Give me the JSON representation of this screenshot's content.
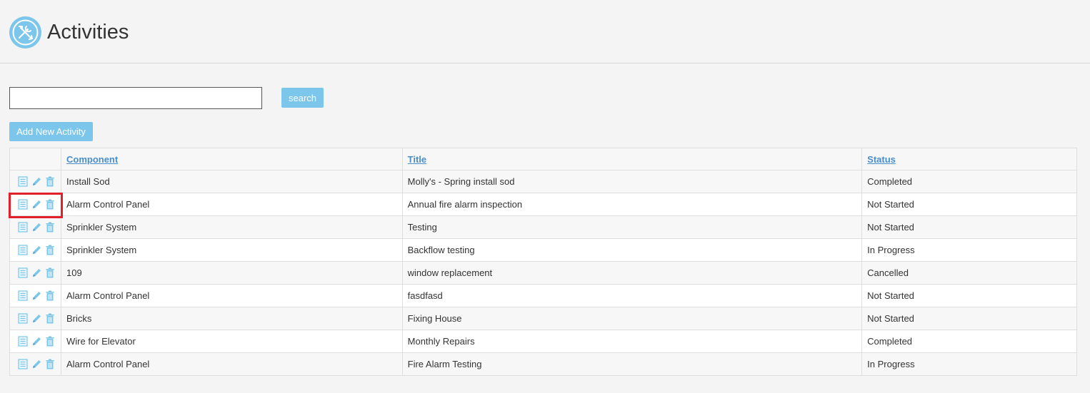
{
  "header": {
    "title": "Activities",
    "logo_icon": "tools-icon",
    "accent_color": "#7cc6ec"
  },
  "search": {
    "value": "",
    "placeholder": "",
    "button_label": "search"
  },
  "toolbar": {
    "add_label": "Add New Activity"
  },
  "table": {
    "columns": {
      "actions": "",
      "component": "Component",
      "title": "Title",
      "status": "Status"
    },
    "row_icons": [
      "details-icon",
      "edit-pencil-icon",
      "delete-trash-icon"
    ],
    "rows": [
      {
        "component": "Install Sod",
        "title": "Molly's - Spring install sod",
        "status": "Completed"
      },
      {
        "component": "Alarm Control Panel",
        "title": "Annual fire alarm inspection",
        "status": "Not Started"
      },
      {
        "component": "Sprinkler System",
        "title": "Testing",
        "status": "Not Started"
      },
      {
        "component": "Sprinkler System",
        "title": "Backflow testing",
        "status": "In Progress"
      },
      {
        "component": "109",
        "title": "window replacement",
        "status": "Cancelled"
      },
      {
        "component": "Alarm Control Panel",
        "title": "fasdfasd",
        "status": "Not Started"
      },
      {
        "component": "Bricks",
        "title": "Fixing House",
        "status": "Not Started"
      },
      {
        "component": "Wire for Elevator",
        "title": "Monthly Repairs",
        "status": "Completed"
      },
      {
        "component": "Alarm Control Panel",
        "title": "Fire Alarm Testing",
        "status": "In Progress"
      }
    ]
  },
  "highlight": {
    "row_index": 1,
    "color": "#e0202a"
  }
}
